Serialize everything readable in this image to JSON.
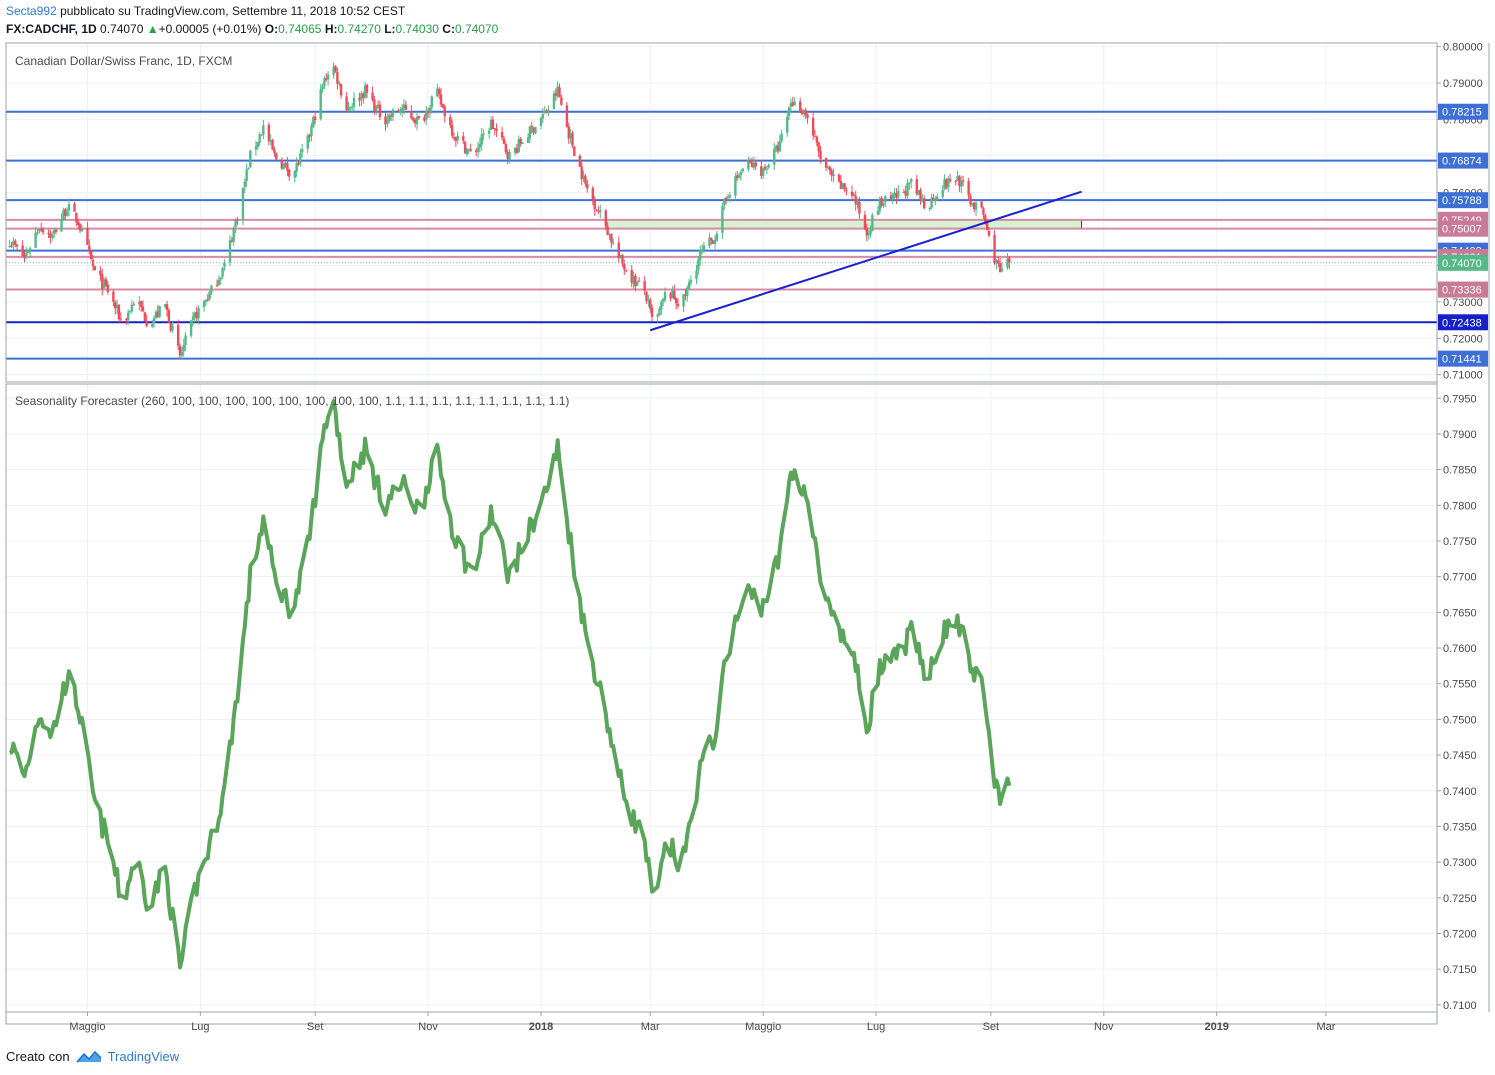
{
  "header": {
    "user": "Secta992",
    "published": "pubblicato su TradingView.com, Settembre 11, 2018 10:52 CEST",
    "symbol": "FX:CADCHF, 1D",
    "last": "0.74070",
    "change": "+0.00005 (+0.01%)",
    "o_label": "O:",
    "o": "0.74065",
    "h_label": "H:",
    "h": "0.74270",
    "l_label": "L:",
    "l": "0.74030",
    "c_label": "C:",
    "c": "0.74070"
  },
  "footer": {
    "created": "Creato con",
    "brand": "TradingView"
  },
  "colors": {
    "up": "#53b987",
    "down": "#eb4d5c",
    "level_blue": "#2962ff",
    "level_pink": "#e08aa4",
    "indicator": "#5aa55a"
  },
  "chart_data": [
    {
      "type": "candlestick",
      "title": "Canadian Dollar/Swiss Franc, 1D, FXCM",
      "ylim": [
        0.708,
        0.801
      ],
      "y_ticks": [
        "0.80000",
        "0.79000",
        "0.78000",
        "0.77000",
        "0.76000",
        "0.75000",
        "0.74000",
        "0.73000",
        "0.72000",
        "0.71000"
      ],
      "x_ticks": [
        {
          "label": "Maggio",
          "bold": false
        },
        {
          "label": "Lug",
          "bold": false
        },
        {
          "label": "Set",
          "bold": false
        },
        {
          "label": "Nov",
          "bold": false
        },
        {
          "label": "2018",
          "bold": true
        },
        {
          "label": "Mar",
          "bold": false
        },
        {
          "label": "Maggio",
          "bold": false
        },
        {
          "label": "Lug",
          "bold": false
        },
        {
          "label": "Set",
          "bold": false
        },
        {
          "label": "Nov",
          "bold": false
        },
        {
          "label": "2019",
          "bold": true
        },
        {
          "label": "Mar",
          "bold": false
        }
      ],
      "levels": [
        {
          "value": "0.78215",
          "price": 0.78215,
          "color": "blue"
        },
        {
          "value": "0.76874",
          "price": 0.76874,
          "color": "blue"
        },
        {
          "value": "0.75788",
          "price": 0.75788,
          "color": "blue"
        },
        {
          "value": "0.75249",
          "price": 0.75249,
          "color": "pink"
        },
        {
          "value": "0.75007",
          "price": 0.75007,
          "color": "pink"
        },
        {
          "value": "0.74403",
          "price": 0.74403,
          "color": "blue"
        },
        {
          "value": "0.74231",
          "price": 0.74231,
          "color": "pink"
        },
        {
          "value": "0.73336",
          "price": 0.73336,
          "color": "pink"
        },
        {
          "value": "0.72438",
          "price": 0.72438,
          "color": "darkblue"
        },
        {
          "value": "0.71441",
          "price": 0.71441,
          "color": "blue"
        }
      ],
      "last_price": {
        "value": "0.74070",
        "price": 0.7407
      },
      "zone": {
        "from_date": "2018-02-05",
        "to_date": "2018-10-20",
        "low": 0.75007,
        "high": 0.75249
      },
      "trendline": {
        "start": {
          "date": "2018-03-01",
          "price": 0.7222
        },
        "end": {
          "date": "2018-10-20",
          "price": 0.7602
        }
      },
      "key_closes": [
        [
          "2017-03-20",
          0.747
        ],
        [
          "2017-03-28",
          0.742
        ],
        [
          "2017-04-05",
          0.751
        ],
        [
          "2017-04-12",
          0.748
        ],
        [
          "2017-04-20",
          0.756
        ],
        [
          "2017-04-26",
          0.752
        ],
        [
          "2017-05-05",
          0.738
        ],
        [
          "2017-05-12",
          0.733
        ],
        [
          "2017-05-20",
          0.724
        ],
        [
          "2017-05-27",
          0.731
        ],
        [
          "2017-06-03",
          0.724
        ],
        [
          "2017-06-12",
          0.729
        ],
        [
          "2017-06-20",
          0.715
        ],
        [
          "2017-06-28",
          0.726
        ],
        [
          "2017-07-07",
          0.733
        ],
        [
          "2017-07-14",
          0.74
        ],
        [
          "2017-07-22",
          0.756
        ],
        [
          "2017-07-28",
          0.77
        ],
        [
          "2017-08-04",
          0.778
        ],
        [
          "2017-08-10",
          0.77
        ],
        [
          "2017-08-20",
          0.765
        ],
        [
          "2017-08-28",
          0.774
        ],
        [
          "2017-09-05",
          0.789
        ],
        [
          "2017-09-10",
          0.796
        ],
        [
          "2017-09-18",
          0.783
        ],
        [
          "2017-09-28",
          0.788
        ],
        [
          "2017-10-08",
          0.78
        ],
        [
          "2017-10-18",
          0.783
        ],
        [
          "2017-10-28",
          0.779
        ],
        [
          "2017-11-05",
          0.788
        ],
        [
          "2017-11-15",
          0.776
        ],
        [
          "2017-11-25",
          0.77
        ],
        [
          "2017-12-05",
          0.779
        ],
        [
          "2017-12-15",
          0.77
        ],
        [
          "2017-12-25",
          0.776
        ],
        [
          "2018-01-05",
          0.783
        ],
        [
          "2018-01-10",
          0.788
        ],
        [
          "2018-01-15",
          0.778
        ],
        [
          "2018-01-25",
          0.762
        ],
        [
          "2018-02-05",
          0.751
        ],
        [
          "2018-02-12",
          0.742
        ],
        [
          "2018-02-20",
          0.736
        ],
        [
          "2018-02-26",
          0.733
        ],
        [
          "2018-03-03",
          0.723
        ],
        [
          "2018-03-10",
          0.733
        ],
        [
          "2018-03-18",
          0.729
        ],
        [
          "2018-03-28",
          0.743
        ],
        [
          "2018-04-05",
          0.748
        ],
        [
          "2018-04-12",
          0.76
        ],
        [
          "2018-04-22",
          0.768
        ],
        [
          "2018-05-01",
          0.766
        ],
        [
          "2018-05-10",
          0.773
        ],
        [
          "2018-05-16",
          0.785
        ],
        [
          "2018-05-24",
          0.782
        ],
        [
          "2018-06-02",
          0.768
        ],
        [
          "2018-06-10",
          0.762
        ],
        [
          "2018-06-18",
          0.76
        ],
        [
          "2018-06-26",
          0.749
        ],
        [
          "2018-07-03",
          0.757
        ],
        [
          "2018-07-10",
          0.758
        ],
        [
          "2018-07-20",
          0.762
        ],
        [
          "2018-07-28",
          0.756
        ],
        [
          "2018-08-06",
          0.762
        ],
        [
          "2018-08-14",
          0.764
        ],
        [
          "2018-08-22",
          0.757
        ],
        [
          "2018-08-28",
          0.754
        ],
        [
          "2018-09-01",
          0.745
        ],
        [
          "2018-09-06",
          0.738
        ],
        [
          "2018-09-11",
          0.7407
        ]
      ]
    },
    {
      "type": "line",
      "title": "Seasonality Forecaster (260, 100, 100, 100, 100, 100, 100, 100, 100, 1.1, 1.1, 1.1, 1.1, 1.1, 1.1, 1.1, 1.1)",
      "ylim": [
        0.709,
        0.797
      ],
      "y_ticks": [
        "0.7950",
        "0.7900",
        "0.7850",
        "0.7800",
        "0.7750",
        "0.7700",
        "0.7650",
        "0.7600",
        "0.7550",
        "0.7500",
        "0.7450",
        "0.7400",
        "0.7350",
        "0.7300",
        "0.7250",
        "0.7200",
        "0.7150",
        "0.7100"
      ]
    }
  ]
}
